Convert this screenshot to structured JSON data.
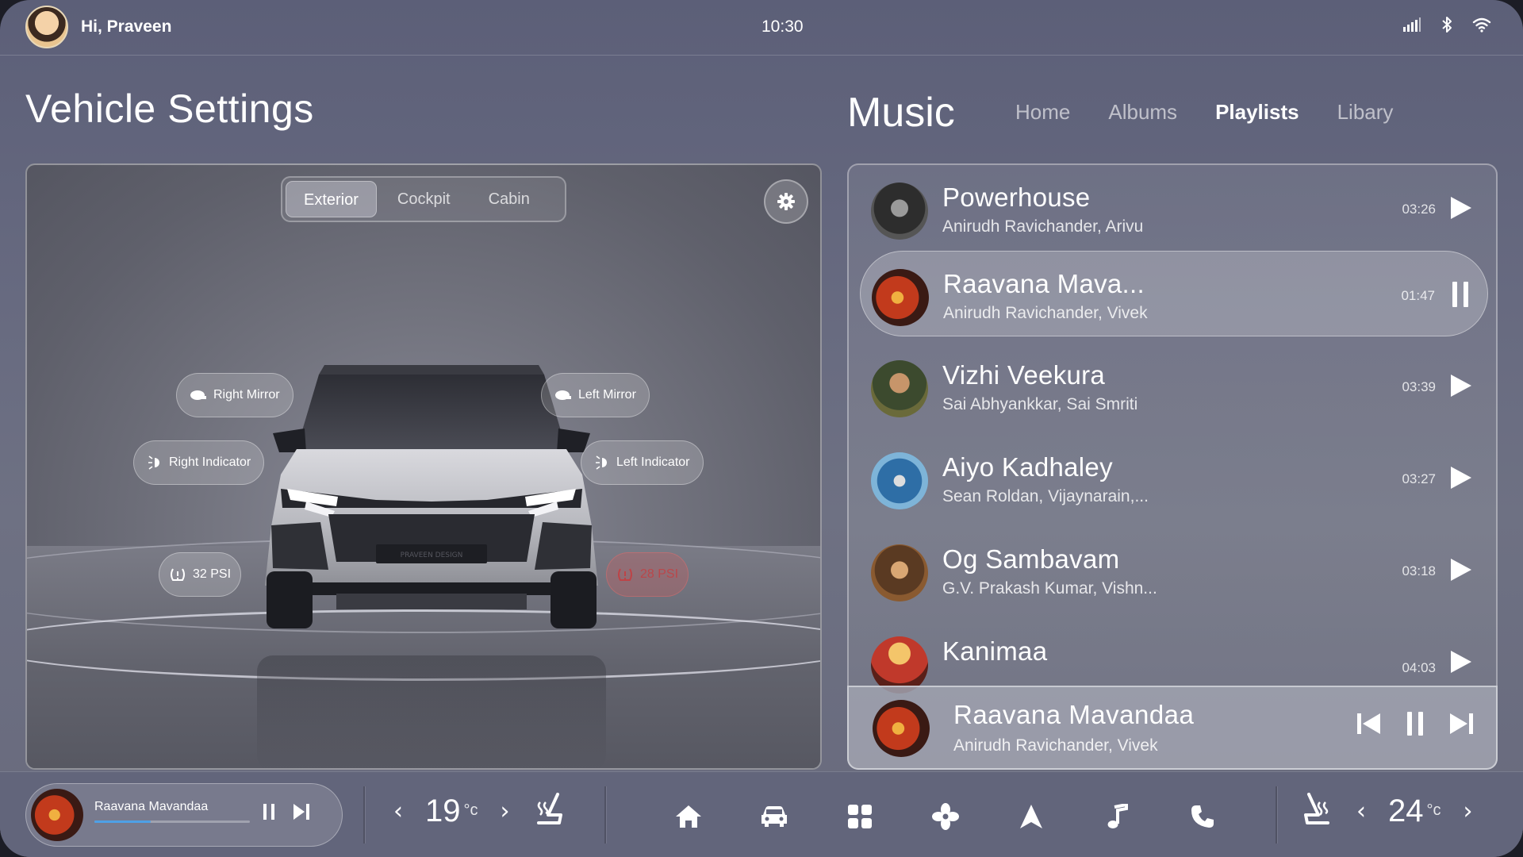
{
  "status": {
    "greeting": "Hi, Praveen",
    "time": "10:30",
    "icons": [
      "signal-icon",
      "bluetooth-icon",
      "wifi-icon"
    ]
  },
  "vehicle": {
    "title": "Vehicle Settings",
    "tabs": [
      "Exterior",
      "Cockpit",
      "Cabin"
    ],
    "active_tab": "Exterior",
    "license_plate": "PRAVEEN DESIGN",
    "hotspots": {
      "right_mirror": "Right Mirror",
      "left_mirror": "Left Mirror",
      "right_indicator": "Right Indicator",
      "left_indicator": "Left Indicator",
      "right_tire": "32 PSI",
      "left_tire": "28 PSI"
    }
  },
  "music": {
    "title": "Music",
    "tabs": [
      "Home",
      "Albums",
      "Playlists",
      "Libary"
    ],
    "active_tab": "Playlists",
    "tracks": [
      {
        "title": "Powerhouse",
        "artist": "Anirudh Ravichander, Arivu",
        "duration": "03:26",
        "state": "play"
      },
      {
        "title": "Raavana Mava...",
        "artist": "Anirudh Ravichander, Vivek",
        "duration": "01:47",
        "state": "pause"
      },
      {
        "title": "Vizhi Veekura",
        "artist": "Sai Abhyankkar, Sai Smriti",
        "duration": "03:39",
        "state": "play"
      },
      {
        "title": "Aiyo Kadhaley",
        "artist": "Sean Roldan, Vijaynarain,...",
        "duration": "03:27",
        "state": "play"
      },
      {
        "title": "Og Sambavam",
        "artist": "G.V. Prakash Kumar, Vishn...",
        "duration": "03:18",
        "state": "play"
      },
      {
        "title": "Kanimaa",
        "artist": "",
        "duration": "04:03",
        "state": "play"
      }
    ],
    "now_playing": {
      "title": "Raavana Mavandaa",
      "artist": "Anirudh Ravichander, Vivek"
    }
  },
  "dock": {
    "mini_player": {
      "title": "Raavana Mavandaa",
      "progress": 0.36
    },
    "left_climate": {
      "temp": "19",
      "unit": "°c"
    },
    "right_climate": {
      "temp": "24",
      "unit": "°c"
    },
    "nav": [
      "home-icon",
      "car-icon",
      "apps-icon",
      "fan-icon",
      "navigation-icon",
      "music-icon",
      "phone-icon"
    ]
  },
  "colors": {
    "accent": "#4ea0e6",
    "warning": "#dc4a4a"
  }
}
